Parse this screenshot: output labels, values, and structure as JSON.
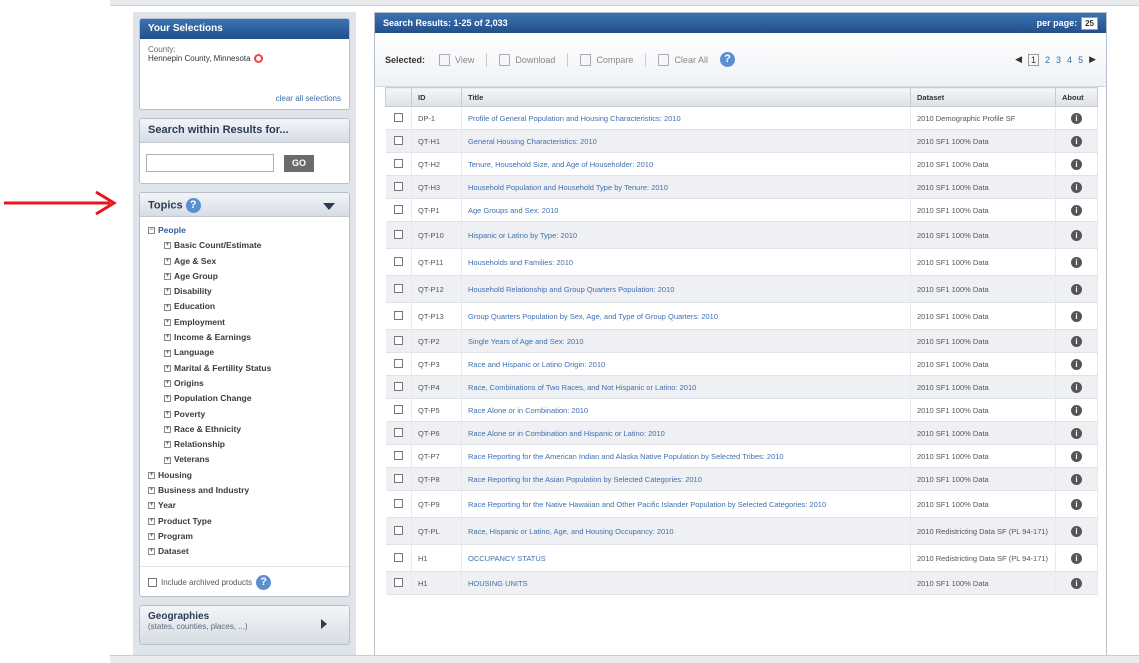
{
  "selections": {
    "header": "Your Selections",
    "label": "County:",
    "value": "Hennepin County, Minnesota",
    "clear": "clear all selections"
  },
  "search": {
    "header": "Search within Results for...",
    "value": "",
    "go": "GO"
  },
  "topics": {
    "header": "Topics",
    "people_label": "People",
    "people_children": [
      "Basic Count/Estimate",
      "Age & Sex",
      "Age Group",
      "Disability",
      "Education",
      "Employment",
      "Income & Earnings",
      "Language",
      "Marital & Fertility Status",
      "Origins",
      "Population Change",
      "Poverty",
      "Race & Ethnicity",
      "Relationship",
      "Veterans"
    ],
    "other_roots": [
      "Housing",
      "Business and Industry",
      "Year",
      "Product Type",
      "Program",
      "Dataset"
    ],
    "archived": "Include archived products"
  },
  "geographies": {
    "title": "Geographies",
    "subtitle": "(states, counties, places, ...)"
  },
  "results": {
    "header": "Search Results:",
    "range": "1-25",
    "of": "of",
    "total": "2,033",
    "per_page_label": "per page:",
    "per_page_value": "25"
  },
  "toolbar": {
    "selected": "Selected:",
    "view": "View",
    "download": "Download",
    "compare": "Compare",
    "clear_all": "Clear All"
  },
  "pager": {
    "prev": "◀",
    "current": "1",
    "pages": [
      "2",
      "3",
      "4",
      "5"
    ],
    "next": "▶"
  },
  "table": {
    "columns": [
      "ID",
      "Title",
      "Dataset",
      "About"
    ],
    "rows": [
      {
        "id": "DP-1",
        "title": "Profile of General Population and Housing Characteristics: 2010",
        "dataset": "2010 Demographic Profile SF"
      },
      {
        "id": "QT-H1",
        "title": "General Housing Characteristics: 2010",
        "dataset": "2010 SF1 100% Data"
      },
      {
        "id": "QT-H2",
        "title": "Tenure, Household Size, and Age of Householder: 2010",
        "dataset": "2010 SF1 100% Data"
      },
      {
        "id": "QT-H3",
        "title": "Household Population and Household Type by Tenure: 2010",
        "dataset": "2010 SF1 100% Data"
      },
      {
        "id": "QT-P1",
        "title": "Age Groups and Sex: 2010",
        "dataset": "2010 SF1 100% Data"
      },
      {
        "id": "QT-P10",
        "title": "Hispanic or Latino by Type: 2010",
        "dataset": "2010 SF1 100% Data"
      },
      {
        "id": "QT-P11",
        "title": "Households and Families: 2010",
        "dataset": "2010 SF1 100% Data"
      },
      {
        "id": "QT-P12",
        "title": "Household Relationship and Group Quarters Population: 2010",
        "dataset": "2010 SF1 100% Data"
      },
      {
        "id": "QT-P13",
        "title": "Group Quarters Population by Sex, Age, and Type of Group Quarters: 2010",
        "dataset": "2010 SF1 100% Data"
      },
      {
        "id": "QT-P2",
        "title": "Single Years of Age and Sex: 2010",
        "dataset": "2010 SF1 100% Data"
      },
      {
        "id": "QT-P3",
        "title": "Race and Hispanic or Latino Origin: 2010",
        "dataset": "2010 SF1 100% Data"
      },
      {
        "id": "QT-P4",
        "title": "Race, Combinations of Two Races, and Not Hispanic or Latino: 2010",
        "dataset": "2010 SF1 100% Data"
      },
      {
        "id": "QT-P5",
        "title": "Race Alone or in Combination: 2010",
        "dataset": "2010 SF1 100% Data"
      },
      {
        "id": "QT-P6",
        "title": "Race Alone or in Combination and Hispanic or Latino: 2010",
        "dataset": "2010 SF1 100% Data"
      },
      {
        "id": "QT-P7",
        "title": "Race Reporting for the American Indian and Alaska Native Population by Selected Tribes: 2010",
        "dataset": "2010 SF1 100% Data"
      },
      {
        "id": "QT-P8",
        "title": "Race Reporting for the Asian Population by Selected Categories: 2010",
        "dataset": "2010 SF1 100% Data"
      },
      {
        "id": "QT-P9",
        "title": "Race Reporting for the Native Hawaiian and Other Pacific Islander Population by Selected Categories: 2010",
        "dataset": "2010 SF1 100% Data"
      },
      {
        "id": "QT-PL",
        "title": "Race, Hispanic or Latino, Age, and Housing Occupancy: 2010",
        "dataset": "2010 Redistricting Data SF (PL 94-171)"
      },
      {
        "id": "H1",
        "title": "OCCUPANCY STATUS",
        "dataset": "2010 Redistricting Data SF (PL 94-171)"
      },
      {
        "id": "H1",
        "title": "HOUSING UNITS",
        "dataset": "2010 SF1 100% Data"
      }
    ]
  },
  "colors": {
    "annotation": "#e8141b",
    "header_blue": "#2b5c99",
    "link": "#3f6fb0"
  }
}
